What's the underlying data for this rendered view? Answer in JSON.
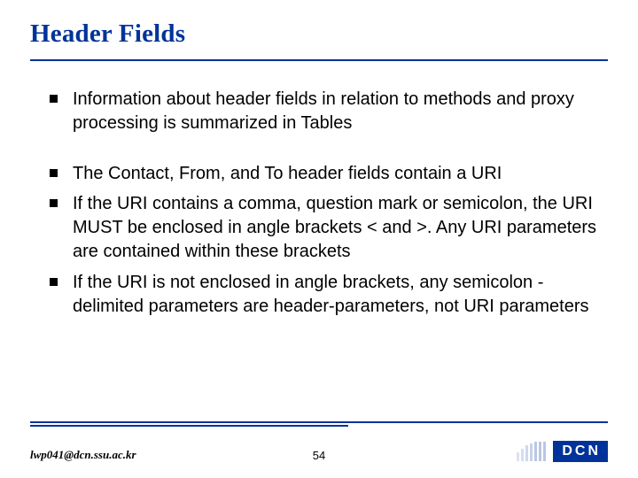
{
  "title": "Header Fields",
  "groupA": {
    "item0": "Information about header fields in relation to methods and proxy processing is summarized in Tables"
  },
  "groupB": {
    "item0": "The Contact, From, and To header fields contain a URI",
    "item1": "If the URI contains a comma, question mark or semicolon, the URI MUST be enclosed in angle brackets < and >.  Any URI parameters are contained within these brackets",
    "item2": "If the URI is not enclosed in angle brackets, any semicolon - delimited parameters are header-parameters,  not URI parameters"
  },
  "footer": {
    "email": "lwp041@dcn.ssu.ac.kr",
    "page": "54",
    "logo": "DCN"
  }
}
